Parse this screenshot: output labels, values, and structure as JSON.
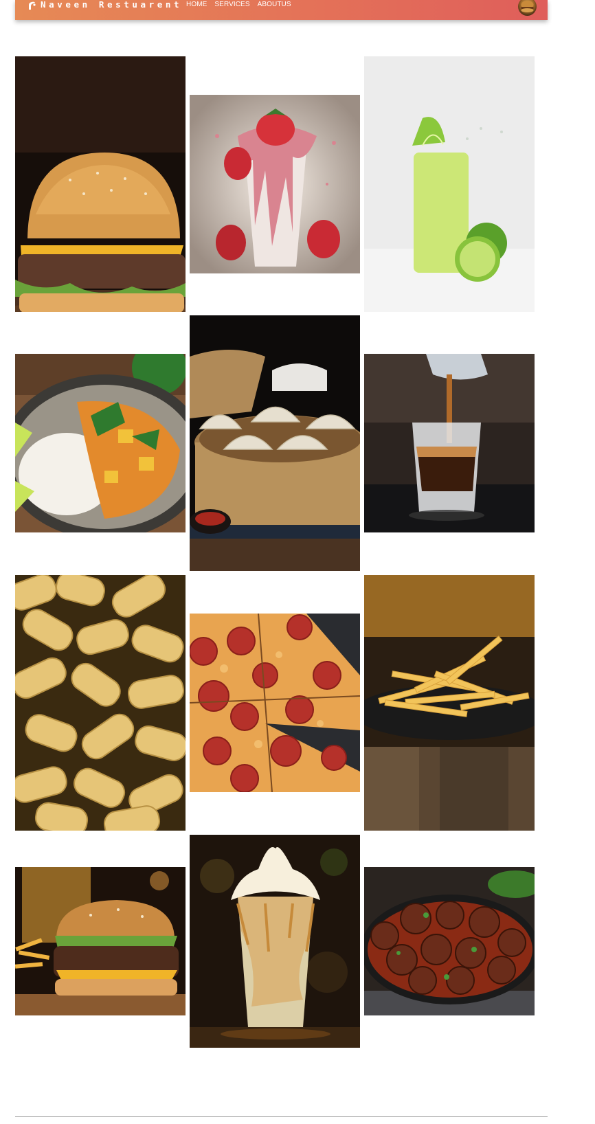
{
  "header": {
    "brand": "Naveen Restuarent",
    "nav": [
      {
        "label": "HOME"
      },
      {
        "label": "SERVICES"
      },
      {
        "label": "ABOUTUS"
      }
    ],
    "gradient_colors": [
      "#e68a55",
      "#df5e5b"
    ]
  },
  "gallery": {
    "photos": [
      {
        "subject": "cheeseburger-photo"
      },
      {
        "subject": "strawberry-milkshake-photo"
      },
      {
        "subject": "lime-juice-photo"
      },
      {
        "subject": "curry-with-rice-photo"
      },
      {
        "subject": "dumplings-in-steamer-photo"
      },
      {
        "subject": "espresso-shot-photo"
      },
      {
        "subject": "rigatoni-pasta-photo"
      },
      {
        "subject": "pepperoni-pizza-photo"
      },
      {
        "subject": "french-fries-photo"
      },
      {
        "subject": "burger-and-fries-photo"
      },
      {
        "subject": "caramel-sundae-photo"
      },
      {
        "subject": "meatballs-in-skillet-photo"
      }
    ]
  }
}
